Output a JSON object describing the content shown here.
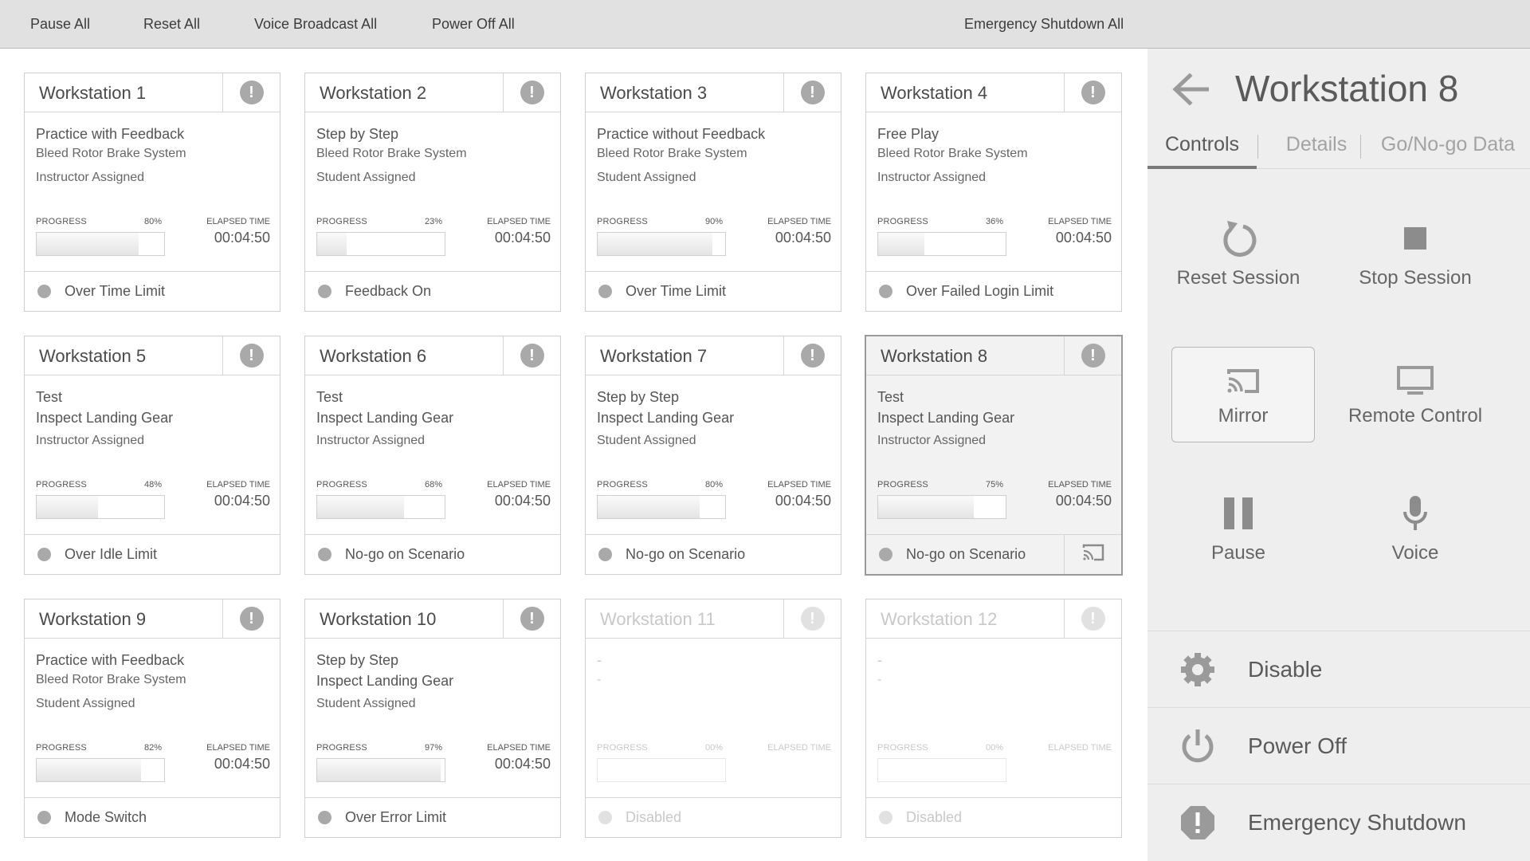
{
  "toolbar": {
    "pause_all": "Pause All",
    "reset_all": "Reset All",
    "voice_broadcast_all": "Voice Broadcast All",
    "power_off_all": "Power Off All",
    "emergency_shutdown_all": "Emergency Shutdown All"
  },
  "labels": {
    "progress": "PROGRESS",
    "elapsed_time": "ELAPSED TIME"
  },
  "workstations": [
    {
      "name": "Workstation 1",
      "mode": "Practice with Feedback",
      "scenario": "Bleed Rotor Brake System",
      "assignment": "Instructor Assigned",
      "progress_pct": "80%",
      "progress": 0.8,
      "elapsed": "00:04:50",
      "status": "Over Time Limit"
    },
    {
      "name": "Workstation 2",
      "mode": "Step by Step",
      "scenario": "Bleed Rotor Brake System",
      "assignment": "Student Assigned",
      "progress_pct": "23%",
      "progress": 0.23,
      "elapsed": "00:04:50",
      "status": "Feedback On"
    },
    {
      "name": "Workstation 3",
      "mode": "Practice without Feedback",
      "scenario": "Bleed Rotor Brake System",
      "assignment": "Student Assigned",
      "progress_pct": "90%",
      "progress": 0.9,
      "elapsed": "00:04:50",
      "status": "Over Time Limit"
    },
    {
      "name": "Workstation 4",
      "mode": "Free Play",
      "scenario": "Bleed Rotor Brake System",
      "assignment": "Instructor Assigned",
      "progress_pct": "36%",
      "progress": 0.36,
      "elapsed": "00:04:50",
      "status": "Over Failed Login Limit"
    },
    {
      "name": "Workstation 5",
      "mode": "Test",
      "scenario": "Inspect Landing Gear",
      "assignment": "Instructor Assigned",
      "progress_pct": "48%",
      "progress": 0.48,
      "elapsed": "00:04:50",
      "status": "Over Idle Limit"
    },
    {
      "name": "Workstation 6",
      "mode": "Test",
      "scenario": "Inspect Landing Gear",
      "assignment": "Instructor Assigned",
      "progress_pct": "68%",
      "progress": 0.68,
      "elapsed": "00:04:50",
      "status": "No-go on Scenario"
    },
    {
      "name": "Workstation 7",
      "mode": "Step by Step",
      "scenario": "Inspect Landing Gear",
      "assignment": "Student Assigned",
      "progress_pct": "80%",
      "progress": 0.8,
      "elapsed": "00:04:50",
      "status": "No-go on Scenario"
    },
    {
      "name": "Workstation 8",
      "mode": "Test",
      "scenario": "Inspect Landing Gear",
      "assignment": "Instructor Assigned",
      "progress_pct": "75%",
      "progress": 0.75,
      "elapsed": "00:04:50",
      "status": "No-go on Scenario"
    },
    {
      "name": "Workstation 9",
      "mode": "Practice with Feedback",
      "scenario": "Bleed Rotor Brake System",
      "assignment": "Student Assigned",
      "progress_pct": "82%",
      "progress": 0.82,
      "elapsed": "00:04:50",
      "status": "Mode Switch"
    },
    {
      "name": "Workstation 10",
      "mode": "Step by Step",
      "scenario": "Inspect Landing Gear",
      "assignment": "Student Assigned",
      "progress_pct": "97%",
      "progress": 0.97,
      "elapsed": "00:04:50",
      "status": "Over Error Limit"
    },
    {
      "name": "Workstation 11",
      "mode": "-",
      "scenario": "-",
      "assignment": "",
      "progress_pct": "00%",
      "progress": 0,
      "elapsed": "",
      "status": "Disabled"
    },
    {
      "name": "Workstation 12",
      "mode": "-",
      "scenario": "-",
      "assignment": "",
      "progress_pct": "00%",
      "progress": 0,
      "elapsed": "",
      "status": "Disabled"
    }
  ],
  "panel": {
    "title": "Workstation 8",
    "tabs": [
      "Controls",
      "Details",
      "Go/No-go Data"
    ],
    "controls": {
      "reset_session": "Reset Session",
      "stop_session": "Stop Session",
      "mirror": "Mirror",
      "remote_control": "Remote Control",
      "pause": "Pause",
      "voice": "Voice"
    },
    "actions": {
      "disable": "Disable",
      "power_off": "Power Off",
      "emergency_shutdown": "Emergency Shutdown"
    }
  },
  "colors": {
    "topbar_bg": "#e1e1e1",
    "panel_bg": "#eeeeee",
    "icon_gray": "#a9a9a9",
    "text": "#4a4a4a"
  }
}
